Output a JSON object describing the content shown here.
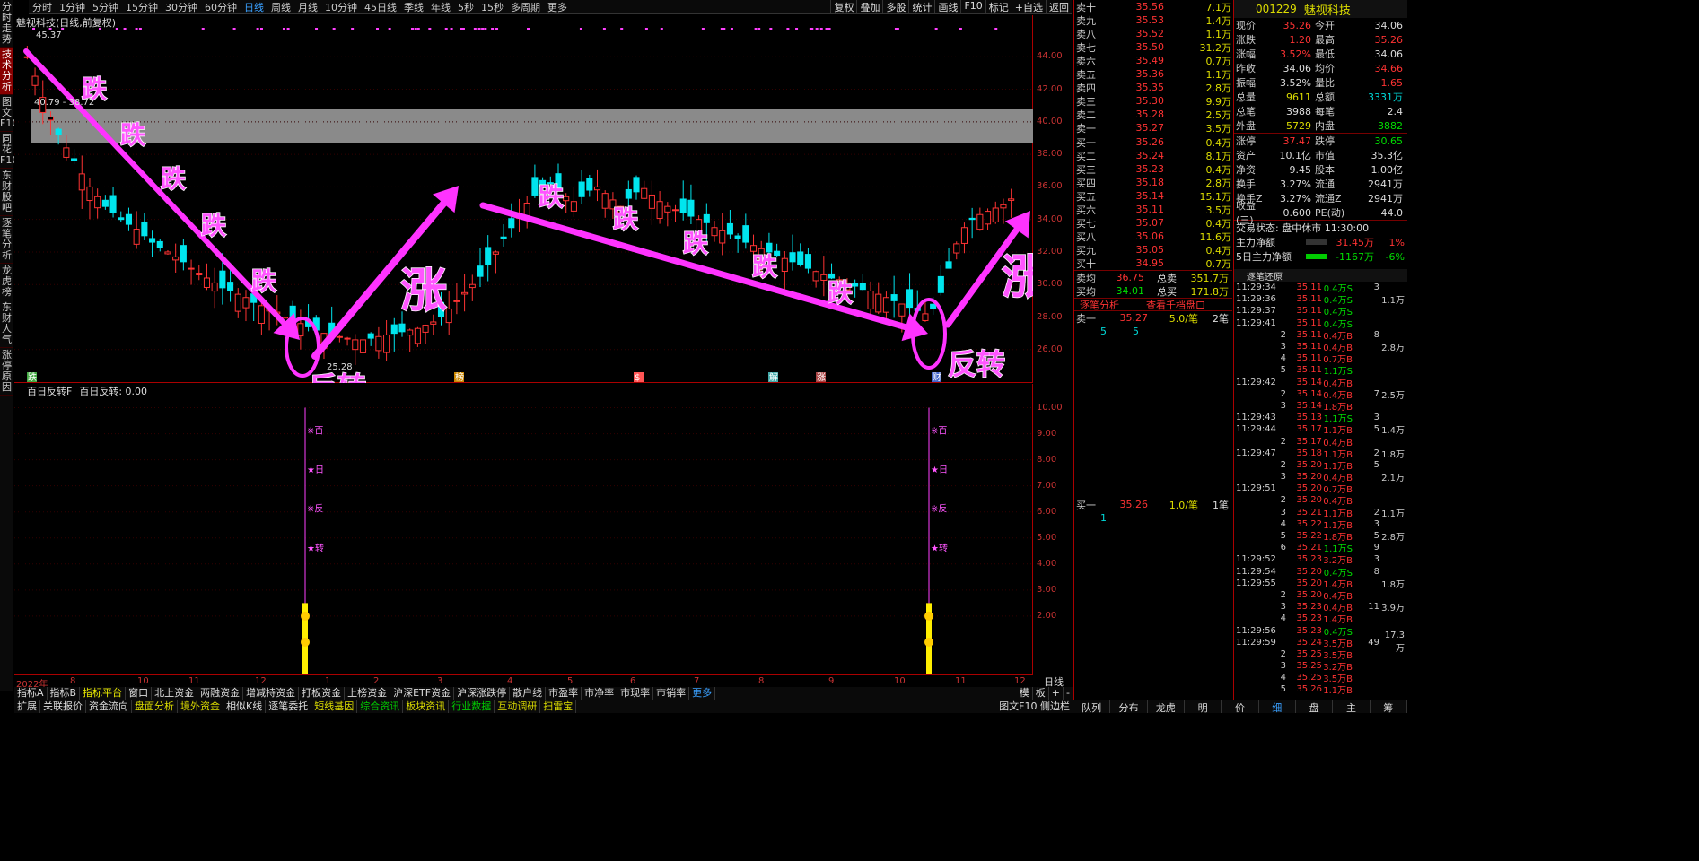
{
  "topbar": {
    "timeframes": [
      "分时",
      "1分钟",
      "5分钟",
      "15分钟",
      "30分钟",
      "60分钟",
      "日线",
      "周线",
      "月线",
      "10分钟",
      "45日线",
      "季线",
      "年线",
      "5秒",
      "15秒",
      "多周期",
      "更多"
    ],
    "right": [
      "复权",
      "叠加",
      "多股",
      "统计",
      "画线",
      "F10",
      "标记",
      "+自选",
      "返回"
    ]
  },
  "lefttabs": [
    "分时走势",
    "技术分析",
    "图文F10",
    "同花F10",
    "东财股吧",
    "逐笔分析",
    "龙虎榜",
    "东财人气",
    "涨停原因"
  ],
  "main": {
    "title": "魅视科技(日线,前复权)",
    "hi_label": "45.37",
    "box_label": "40.79 - 38.72",
    "lo_label": "25.28",
    "annotations": {
      "die": "跌",
      "zhang": "涨",
      "fanzhuan": "反转"
    },
    "event_labels": [
      "跌",
      "榜",
      "$",
      "解",
      "涨",
      "财"
    ]
  },
  "sub": {
    "title": "百日反转F",
    "value_label": "百日反转: 0.00",
    "markers": [
      "※百",
      "★日",
      "※反",
      "★转"
    ]
  },
  "axis_main": [
    "44.00",
    "42.00",
    "40.00",
    "38.00",
    "36.00",
    "34.00",
    "32.00",
    "30.00",
    "28.00",
    "26.00"
  ],
  "axis_sub": [
    "10.00",
    "9.00",
    "8.00",
    "7.00",
    "6.00",
    "5.00",
    "4.00",
    "3.00",
    "2.00"
  ],
  "dates": [
    "2022年",
    "8",
    "10",
    "11",
    "12",
    "1",
    "2",
    "3",
    "4",
    "5",
    "6",
    "7",
    "8",
    "9",
    "10",
    "11",
    "12"
  ],
  "axis_label": "日线",
  "tabs": [
    "指标A",
    "指标B",
    "指标平台",
    "窗口",
    "北上资金",
    "两融资金",
    "增减持资金",
    "打板资金",
    "上榜资金",
    "沪深ETF资金",
    "沪深涨跌停",
    "散户线",
    "市盈率",
    "市净率",
    "市现率",
    "市销率",
    "更多"
  ],
  "tabs_right": [
    "模",
    "板",
    "+",
    "-"
  ],
  "bottom": [
    "扩展",
    "关联报价",
    "资金流向",
    "盘面分析",
    "境外资金",
    "相似K线",
    "逐笔委托",
    "短线基因",
    "综合资讯",
    "板块资讯",
    "行业数据",
    "互动调研",
    "扫雷宝"
  ],
  "bottom_right": "图文F10 侧边栏",
  "orderbook": {
    "asks": [
      {
        "l": "卖十",
        "p": "35.56",
        "v": "7.1万"
      },
      {
        "l": "卖九",
        "p": "35.53",
        "v": "1.4万"
      },
      {
        "l": "卖八",
        "p": "35.52",
        "v": "1.1万"
      },
      {
        "l": "卖七",
        "p": "35.50",
        "v": "31.2万"
      },
      {
        "l": "卖六",
        "p": "35.49",
        "v": "0.7万"
      },
      {
        "l": "卖五",
        "p": "35.36",
        "v": "1.1万"
      },
      {
        "l": "卖四",
        "p": "35.35",
        "v": "2.8万"
      },
      {
        "l": "卖三",
        "p": "35.30",
        "v": "9.9万"
      },
      {
        "l": "卖二",
        "p": "35.28",
        "v": "2.5万"
      },
      {
        "l": "卖一",
        "p": "35.27",
        "v": "3.5万"
      }
    ],
    "bids": [
      {
        "l": "买一",
        "p": "35.26",
        "v": "0.4万"
      },
      {
        "l": "买二",
        "p": "35.24",
        "v": "8.1万"
      },
      {
        "l": "买三",
        "p": "35.23",
        "v": "0.4万"
      },
      {
        "l": "买四",
        "p": "35.18",
        "v": "2.8万"
      },
      {
        "l": "买五",
        "p": "35.14",
        "v": "15.1万"
      },
      {
        "l": "买六",
        "p": "35.11",
        "v": "3.5万"
      },
      {
        "l": "买七",
        "p": "35.07",
        "v": "0.4万"
      },
      {
        "l": "买八",
        "p": "35.06",
        "v": "11.6万"
      },
      {
        "l": "买九",
        "p": "35.05",
        "v": "0.4万"
      },
      {
        "l": "买十",
        "p": "34.95",
        "v": "0.7万"
      }
    ],
    "avg_ask": {
      "l": "卖均",
      "p": "36.75",
      "k": "总卖",
      "v": "351.7万"
    },
    "avg_bid": {
      "l": "买均",
      "p": "34.01",
      "k": "总买",
      "v": "171.8万"
    },
    "links": [
      "逐笔分析",
      "查看千档盘口"
    ],
    "sell1": {
      "l": "卖一",
      "p": "35.27",
      "v": "5.0/笔",
      "n": "2笔",
      "q": [
        "5",
        "5"
      ]
    },
    "buy1": {
      "l": "买一",
      "p": "35.26",
      "v": "1.0/笔",
      "n": "1笔",
      "q": [
        "1"
      ]
    }
  },
  "info": {
    "code": "001229",
    "name": "魅视科技",
    "rows": [
      [
        "现价",
        "35.26",
        "今开",
        "34.06"
      ],
      [
        "涨跌",
        "1.20",
        "最高",
        "35.26"
      ],
      [
        "涨幅",
        "3.52%",
        "最低",
        "34.06"
      ],
      [
        "昨收",
        "34.06",
        "均价",
        "34.66"
      ],
      [
        "振幅",
        "3.52%",
        "量比",
        "1.65"
      ],
      [
        "总量",
        "9611",
        "总额",
        "3331万"
      ],
      [
        "总笔",
        "3988",
        "每笔",
        "2.4"
      ],
      [
        "外盘",
        "5729",
        "内盘",
        "3882"
      ]
    ],
    "rows2": [
      [
        "涨停",
        "37.47",
        "跌停",
        "30.65"
      ],
      [
        "资产",
        "10.1亿",
        "市值",
        "35.3亿"
      ],
      [
        "净资",
        "9.45",
        "股本",
        "1.00亿"
      ],
      [
        "换手",
        "3.27%",
        "流通",
        "2941万"
      ],
      [
        "换手Z",
        "3.27%",
        "流通Z",
        "2941万"
      ],
      [
        "收益(三)",
        "0.600",
        "PE(动)",
        "44.0"
      ]
    ],
    "status": "交易状态: 盘中休市 11:30:00",
    "mf1": {
      "k": "主力净额",
      "v": "31.45万",
      "p": "1%"
    },
    "mf2": {
      "k": "5日主力净额",
      "v": "-1167万",
      "p": "-6%"
    },
    "ticks_title": "逐笔还原"
  },
  "ticks": [
    [
      "11:29:34",
      "35.11",
      "0.4万S",
      "3",
      ""
    ],
    [
      "11:29:36",
      "35.11",
      "0.4万S",
      "",
      "1.1万"
    ],
    [
      "11:29:37",
      "35.11",
      "0.4万S",
      "",
      ""
    ],
    [
      "11:29:41",
      "35.11",
      "0.4万S",
      "",
      ""
    ],
    [
      "2",
      "35.11",
      "0.4万B",
      "8",
      ""
    ],
    [
      "3",
      "35.11",
      "0.4万B",
      "",
      "2.8万"
    ],
    [
      "4",
      "35.11",
      "0.7万B",
      "",
      ""
    ],
    [
      "5",
      "35.11",
      "1.1万S",
      "",
      ""
    ],
    [
      "11:29:42",
      "35.14",
      "0.4万B",
      "",
      ""
    ],
    [
      "2",
      "35.14",
      "0.4万B",
      "7",
      "2.5万"
    ],
    [
      "3",
      "35.14",
      "1.8万B",
      "",
      ""
    ],
    [
      "11:29:43",
      "35.13",
      "1.1万S",
      "3",
      ""
    ],
    [
      "11:29:44",
      "35.17",
      "1.1万B",
      "5",
      "1.4万"
    ],
    [
      "2",
      "35.17",
      "0.4万B",
      "",
      ""
    ],
    [
      "11:29:47",
      "35.18",
      "1.1万B",
      "2",
      "1.8万"
    ],
    [
      "2",
      "35.20",
      "1.1万B",
      "5",
      ""
    ],
    [
      "3",
      "35.20",
      "0.4万B",
      "",
      "2.1万"
    ],
    [
      "11:29:51",
      "35.20",
      "0.7万B",
      "",
      ""
    ],
    [
      "2",
      "35.20",
      "0.4万B",
      "",
      ""
    ],
    [
      "3",
      "35.21",
      "1.1万B",
      "2",
      "1.1万"
    ],
    [
      "4",
      "35.22",
      "1.1万B",
      "3",
      ""
    ],
    [
      "5",
      "35.22",
      "1.8万B",
      "5",
      "2.8万"
    ],
    [
      "6",
      "35.21",
      "1.1万S",
      "9",
      ""
    ],
    [
      "11:29:52",
      "35.23",
      "3.2万B",
      "3",
      ""
    ],
    [
      "11:29:54",
      "35.20",
      "0.4万S",
      "8",
      ""
    ],
    [
      "11:29:55",
      "35.20",
      "1.4万B",
      "",
      "1.8万"
    ],
    [
      "2",
      "35.20",
      "0.4万B",
      "",
      ""
    ],
    [
      "3",
      "35.23",
      "0.4万B",
      "11",
      "3.9万"
    ],
    [
      "4",
      "35.23",
      "1.4万B",
      "",
      ""
    ],
    [
      "11:29:56",
      "35.23",
      "0.4万S",
      "",
      ""
    ],
    [
      "11:29:59",
      "35.24",
      "3.5万B",
      "49",
      "17.3万"
    ],
    [
      "2",
      "35.25",
      "3.5万B",
      "",
      ""
    ],
    [
      "3",
      "35.25",
      "3.2万B",
      "",
      ""
    ],
    [
      "4",
      "35.25",
      "3.5万B",
      "",
      ""
    ],
    [
      "5",
      "35.26",
      "1.1万B",
      "",
      ""
    ]
  ],
  "rbot": [
    "队列",
    "分布",
    "龙虎",
    "明",
    "价",
    "细",
    "盘",
    "主",
    "筹"
  ],
  "candles_seed": "ohlc",
  "chart_data": {
    "type": "candlestick",
    "xlabel": "",
    "ylabel": "",
    "ylim": [
      24.5,
      46
    ],
    "series": [
      {
        "values": [
          44.0,
          42.8,
          41.5,
          40.3,
          39.2,
          38.4,
          37.6,
          36.8,
          36.0,
          35.4,
          34.8,
          34.4,
          34.0,
          33.7,
          33.4,
          33.0,
          32.6,
          32.3,
          32.0,
          31.7,
          31.4,
          31.0,
          30.7,
          30.4,
          30.1,
          29.8,
          29.6,
          29.4,
          29.2,
          28.9,
          28.7,
          28.5,
          28.3,
          28.0,
          27.8,
          27.6,
          27.4,
          27.2,
          27.0,
          26.9,
          26.8,
          26.7,
          26.6,
          26.6,
          26.7,
          26.8,
          26.9,
          27.0,
          27.1,
          27.2,
          27.3,
          27.5,
          27.7,
          28.0,
          28.5,
          29.0,
          29.5,
          30.0,
          30.5,
          31.2,
          32.0,
          32.8,
          33.5,
          34.2,
          35.0,
          35.5,
          36.0,
          36.2,
          35.8,
          35.4,
          35.1,
          35.4,
          35.8,
          36.0,
          35.6,
          35.2,
          34.8,
          35.3,
          35.7,
          35.9,
          35.5,
          35.1,
          34.8,
          34.6,
          34.4,
          34.2,
          34.0,
          33.8,
          33.5,
          33.3,
          33.1,
          32.8,
          32.6,
          32.4,
          32.2,
          32.0,
          31.8,
          31.6,
          31.4,
          31.2,
          31.0,
          30.8,
          30.6,
          30.4,
          30.3,
          30.1,
          29.9,
          29.7,
          29.6,
          29.4,
          29.2,
          29.0,
          28.8,
          28.6,
          28.4,
          28.2,
          28.5,
          29.5,
          31.0,
          32.5,
          33.5,
          34.0,
          34.3,
          34.5,
          34.7,
          34.9,
          35.26
        ]
      }
    ]
  }
}
